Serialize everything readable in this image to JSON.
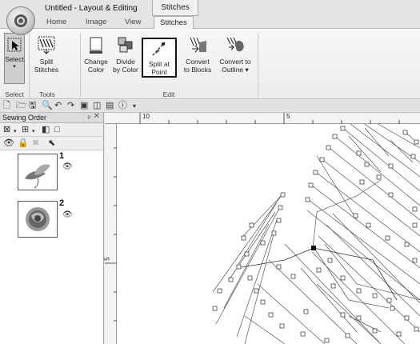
{
  "window": {
    "title": "Untitled - Layout & Editing",
    "context_tab_title": "Stitches"
  },
  "tabs": [
    {
      "label": "Home",
      "active": false
    },
    {
      "label": "Image",
      "active": false
    },
    {
      "label": "View",
      "active": false
    },
    {
      "label": "Stitches",
      "active": true
    }
  ],
  "ribbon": {
    "select": {
      "label": "Select",
      "dropdown": "▾",
      "group": "Select"
    },
    "split_stitches": {
      "line1": "Split",
      "line2": "Stitches",
      "group": "Tools"
    },
    "change_color": {
      "line1": "Change",
      "line2": "Color"
    },
    "divide_by_color": {
      "line1": "Divide",
      "line2": "by Color"
    },
    "split_at_point": {
      "line1": "Split at",
      "line2": "Point"
    },
    "convert_to_blocks": {
      "line1": "Convert",
      "line2": "to Blocks"
    },
    "convert_to_outline": {
      "line1": "Convert to",
      "line2": "Outline ▾"
    },
    "edit_group": "Edit"
  },
  "quick_access": [
    "new-icon",
    "open-icon",
    "save-icon",
    "zoom-icon",
    "undo-icon",
    "redo-icon",
    "view-icon",
    "layout-icon",
    "properties-icon",
    "help-icon",
    "customize-icon"
  ],
  "panel": {
    "title": "Sewing Order",
    "pin": "ᵖ",
    "close": "✕",
    "items": [
      {
        "number": "1",
        "visible": true
      },
      {
        "number": "2",
        "visible": true
      }
    ]
  },
  "ruler": {
    "unit": "mm",
    "h_labels": [
      "10",
      "5"
    ],
    "v_label": "5"
  }
}
